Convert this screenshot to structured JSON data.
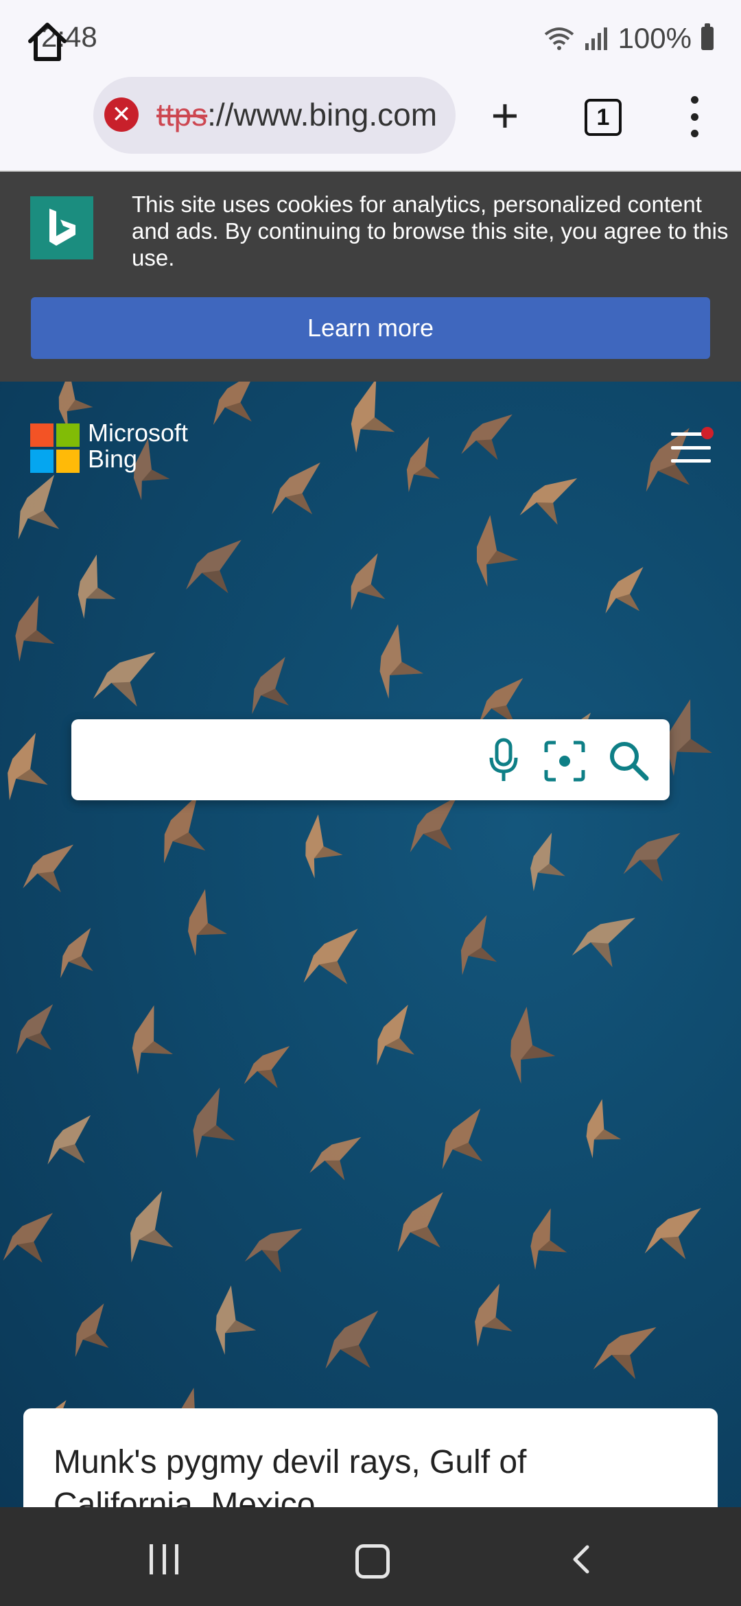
{
  "status_bar": {
    "time": "2:48",
    "battery": "100%"
  },
  "browser": {
    "url_scheme": "ttps",
    "url_rest": "://www.bing.com",
    "tab_count": "1",
    "new_tab_label": "+"
  },
  "cookie_banner": {
    "text": "This site uses cookies for analytics, personalized content and ads. By continuing to browse this site, you agree to this use.",
    "button": "Learn more"
  },
  "header": {
    "brand_line1": "Microsoft",
    "brand_line2": "Bing"
  },
  "search": {
    "placeholder": "",
    "value": ""
  },
  "caption": {
    "title": "Munk's pygmy devil rays, Gulf of California, Mexico"
  },
  "colors": {
    "ms_red": "#f35325",
    "ms_green": "#81bc06",
    "ms_blue": "#05a6f0",
    "ms_yellow": "#ffba08",
    "bing_teal": "#1b8d7f",
    "search_icon": "#0e7f86",
    "learn_more": "#3f67be",
    "error_red": "#c8202b"
  },
  "icons": {
    "home": "home-icon",
    "error": "error-icon",
    "mic": "microphone-icon",
    "visual": "visual-search-icon",
    "search": "search-icon",
    "menu": "hamburger-icon"
  }
}
